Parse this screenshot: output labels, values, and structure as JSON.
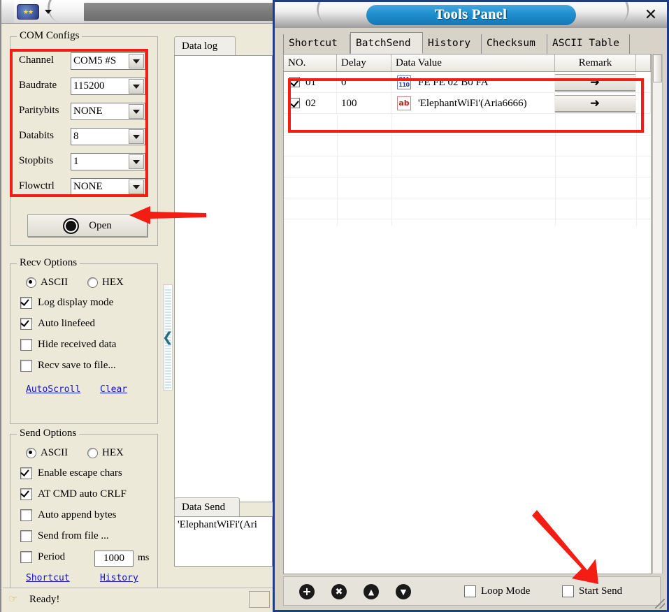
{
  "left_window": {
    "toolbar": {
      "logo_icon": "app-logo-icon",
      "dropdown_caret": "caret-down-icon"
    },
    "com_configs": {
      "title": "COM Configs",
      "rows": [
        {
          "label": "Channel",
          "value": "COM5 #S"
        },
        {
          "label": "Baudrate",
          "value": "115200"
        },
        {
          "label": "Paritybits",
          "value": "NONE"
        },
        {
          "label": "Databits",
          "value": "8"
        },
        {
          "label": "Stopbits",
          "value": "1"
        },
        {
          "label": "Flowctrl",
          "value": "NONE"
        }
      ],
      "open_button": "Open"
    },
    "recv_options": {
      "title": "Recv Options",
      "radios": [
        {
          "label": "ASCII",
          "checked": true
        },
        {
          "label": "HEX",
          "checked": false
        }
      ],
      "checks": [
        {
          "label": "Log display mode",
          "checked": true
        },
        {
          "label": "Auto linefeed",
          "checked": true
        },
        {
          "label": "Hide received data",
          "checked": false
        },
        {
          "label": "Recv save to file...",
          "checked": false
        }
      ],
      "links": [
        "AutoScroll",
        "Clear"
      ]
    },
    "send_options": {
      "title": "Send Options",
      "radios": [
        {
          "label": "ASCII",
          "checked": true
        },
        {
          "label": "HEX",
          "checked": false
        }
      ],
      "checks": [
        {
          "label": "Enable escape chars",
          "checked": true
        },
        {
          "label": "AT CMD auto CRLF",
          "checked": true
        },
        {
          "label": "Auto append bytes",
          "checked": false
        },
        {
          "label": "Send from file ...",
          "checked": false
        },
        {
          "label": "Period",
          "checked": false
        }
      ],
      "period_value": "1000",
      "period_unit": "ms",
      "links": [
        "Shortcut",
        "History"
      ]
    },
    "data_log": {
      "tab_label": "Data log",
      "content": ""
    },
    "data_send": {
      "tab_label": "Data Send",
      "content": "'ElephantWiFi'(Ari"
    },
    "splitter": {
      "arrow": "chevron-left-icon"
    },
    "statusbar": {
      "icon": "hand-pointer-icon",
      "text": "Ready!"
    }
  },
  "tools_panel": {
    "title": "Tools Panel",
    "close_label": "✕",
    "tabs": [
      {
        "label": "Shortcut",
        "active": false
      },
      {
        "label": "BatchSend",
        "active": true
      },
      {
        "label": "History",
        "active": false
      },
      {
        "label": "Checksum",
        "active": false
      },
      {
        "label": "ASCII Table",
        "active": false
      }
    ],
    "grid": {
      "columns": [
        "NO.",
        "Delay",
        "Data Value",
        "Remark"
      ],
      "rows": [
        {
          "checked": true,
          "no": "01",
          "delay": "0",
          "icon": "hex-data-icon",
          "icon_text": "011 110",
          "value": "FE FE 02 B0 FA",
          "remark_icon": "send-arrow-icon"
        },
        {
          "checked": true,
          "no": "02",
          "delay": "100",
          "icon": "ascii-data-icon",
          "icon_text": "ab",
          "value": "'ElephantWiFi'(Aria6666)",
          "remark_icon": "send-arrow-icon"
        }
      ]
    },
    "bottom_bar": {
      "buttons": [
        {
          "name": "add-row-button",
          "glyph": "+"
        },
        {
          "name": "delete-row-button",
          "glyph": "✖"
        },
        {
          "name": "move-up-button",
          "glyph": "▲"
        },
        {
          "name": "move-down-button",
          "glyph": "▼"
        }
      ],
      "checkboxes": [
        {
          "label": "Loop Mode",
          "checked": false
        },
        {
          "label": "Start Send",
          "checked": false
        }
      ]
    }
  },
  "annotations": {
    "color": "#f41d14",
    "rect_com_configs": "highlight-com-configs",
    "rect_batch_rows": "highlight-batch-rows",
    "arrow_open": "arrow-to-open-button",
    "arrow_start_send": "arrow-to-start-send"
  }
}
